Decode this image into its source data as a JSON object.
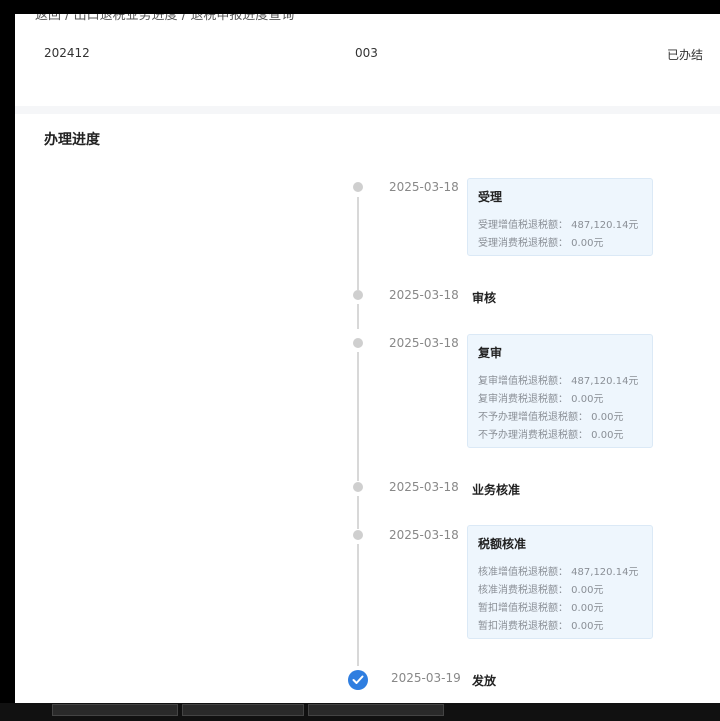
{
  "breadcrumb": {
    "back": "返回",
    "trail": "/ 出口退税业务进度 / 退税申报进度查询"
  },
  "record": {
    "period": "202412",
    "sequence": "003",
    "status": "已办结"
  },
  "progress": {
    "title": "办理进度",
    "steps": [
      {
        "date": "2025-03-18",
        "name": "受理",
        "details": [
          "受理增值税退税额： 487,120.14元",
          "受理消费税退税额： 0.00元"
        ]
      },
      {
        "date": "2025-03-18",
        "name": "审核",
        "details": []
      },
      {
        "date": "2025-03-18",
        "name": "复审",
        "details": [
          "复审增值税退税额： 487,120.14元",
          "复审消费税退税额： 0.00元",
          "不予办理增值税退税额： 0.00元",
          "不予办理消费税退税额： 0.00元"
        ]
      },
      {
        "date": "2025-03-18",
        "name": "业务核准",
        "details": []
      },
      {
        "date": "2025-03-18",
        "name": "税额核准",
        "details": [
          "核准增值税退税额： 487,120.14元",
          "核准消费税退税额： 0.00元",
          "暂扣增值税退税额： 0.00元",
          "暂扣消费税退税额： 0.00元"
        ]
      },
      {
        "date": "2025-03-19",
        "name": "发放",
        "details": []
      }
    ]
  },
  "icons": {
    "pending": "dot-icon",
    "completed": "check-circle-icon"
  },
  "colors": {
    "accent": "#2f7ee0",
    "box_bg": "#eef6fd",
    "line": "#d8d8d8"
  }
}
